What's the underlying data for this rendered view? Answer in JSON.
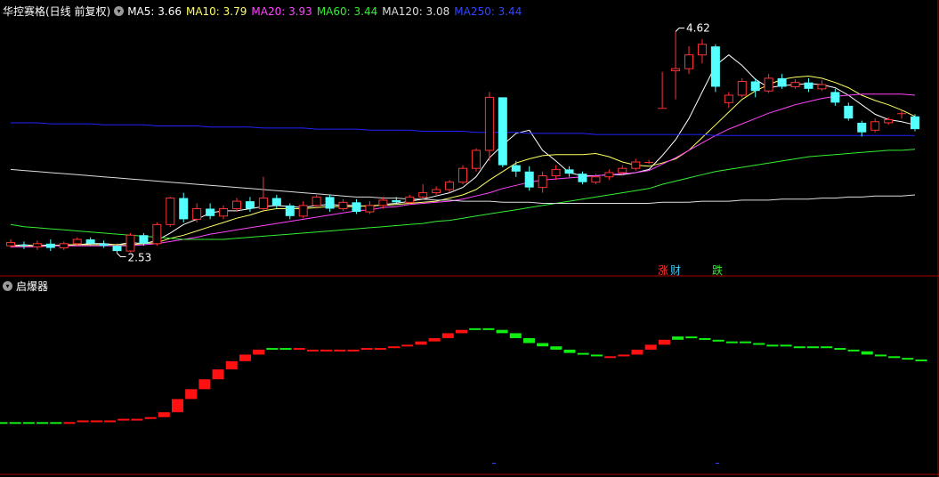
{
  "header": {
    "title": "华控赛格(日线 前复权)",
    "ma": [
      {
        "label": "MA5: ",
        "value": "3.66",
        "color": "#ffffff"
      },
      {
        "label": "MA10: ",
        "value": "3.79",
        "color": "#ffff66"
      },
      {
        "label": "MA20: ",
        "value": "3.93",
        "color": "#ff44ff"
      },
      {
        "label": "MA60: ",
        "value": "3.44",
        "color": "#33ee33"
      },
      {
        "label": "MA120: ",
        "value": "3.08",
        "color": "#dddddd"
      },
      {
        "label": "MA250: ",
        "value": "3.44",
        "color": "#3344ff"
      }
    ]
  },
  "sub_panel": {
    "title": "启爆器"
  },
  "tags": [
    {
      "text": "涨",
      "color": "#ff3333"
    },
    {
      "text": "财",
      "color": "#33ccff"
    },
    {
      "text": "跌",
      "color": "#33ee33"
    }
  ],
  "chart_data": [
    {
      "type": "candlestick",
      "title": "华控赛格(日线 前复权)",
      "ylim": [
        2.4,
        4.75
      ],
      "colors": {
        "up": "#ff3333",
        "down": "#54ffff",
        "ma250_line": "#2222ff"
      },
      "annotations": [
        {
          "text": "4.62",
          "kind": "high",
          "bar": 50,
          "value": 4.62
        },
        {
          "text": "2.53",
          "kind": "low",
          "bar": 8,
          "value": 2.53
        }
      ],
      "bars": [
        [
          2.6,
          2.63,
          2.66,
          2.58
        ],
        [
          2.61,
          2.6,
          2.64,
          2.57
        ],
        [
          2.59,
          2.62,
          2.65,
          2.56
        ],
        [
          2.62,
          2.58,
          2.66,
          2.55
        ],
        [
          2.58,
          2.62,
          2.64,
          2.56
        ],
        [
          2.62,
          2.66,
          2.68,
          2.6
        ],
        [
          2.66,
          2.62,
          2.68,
          2.6
        ],
        [
          2.62,
          2.6,
          2.65,
          2.58
        ],
        [
          2.6,
          2.55,
          2.62,
          2.53
        ],
        [
          2.55,
          2.7,
          2.72,
          2.54
        ],
        [
          2.7,
          2.62,
          2.72,
          2.6
        ],
        [
          2.62,
          2.8,
          2.82,
          2.6
        ],
        [
          2.8,
          3.05,
          3.06,
          2.78
        ],
        [
          3.05,
          2.85,
          3.1,
          2.82
        ],
        [
          2.85,
          2.95,
          3.0,
          2.82
        ],
        [
          2.95,
          2.88,
          3.0,
          2.85
        ],
        [
          2.88,
          2.95,
          2.98,
          2.85
        ],
        [
          2.95,
          3.02,
          3.05,
          2.92
        ],
        [
          3.02,
          2.95,
          3.06,
          2.92
        ],
        [
          2.95,
          3.05,
          3.25,
          2.93
        ],
        [
          3.05,
          2.98,
          3.08,
          2.95
        ],
        [
          2.98,
          2.88,
          3.0,
          2.85
        ],
        [
          2.88,
          2.98,
          3.02,
          2.86
        ],
        [
          2.98,
          3.06,
          3.08,
          2.95
        ],
        [
          3.06,
          2.95,
          3.08,
          2.92
        ],
        [
          2.95,
          3.01,
          3.04,
          2.93
        ],
        [
          3.01,
          2.92,
          3.04,
          2.9
        ],
        [
          2.92,
          2.98,
          3.02,
          2.9
        ],
        [
          2.98,
          3.03,
          3.06,
          2.95
        ],
        [
          3.03,
          3.01,
          3.06,
          2.99
        ],
        [
          3.01,
          3.06,
          3.08,
          2.99
        ],
        [
          3.06,
          3.1,
          3.18,
          3.04
        ],
        [
          3.1,
          3.13,
          3.16,
          3.08
        ],
        [
          3.13,
          3.2,
          3.22,
          3.1
        ],
        [
          3.2,
          3.33,
          3.36,
          3.18
        ],
        [
          3.33,
          3.5,
          3.52,
          3.3
        ],
        [
          3.5,
          4.0,
          4.05,
          3.4
        ],
        [
          4.0,
          3.36,
          4.0,
          3.34
        ],
        [
          3.36,
          3.3,
          3.4,
          3.25
        ],
        [
          3.3,
          3.15,
          3.35,
          3.12
        ],
        [
          3.15,
          3.26,
          3.3,
          3.1
        ],
        [
          3.26,
          3.32,
          3.36,
          3.22
        ],
        [
          3.32,
          3.28,
          3.35,
          3.25
        ],
        [
          3.28,
          3.2,
          3.3,
          3.18
        ],
        [
          3.2,
          3.25,
          3.28,
          3.18
        ],
        [
          3.25,
          3.29,
          3.32,
          3.22
        ],
        [
          3.29,
          3.33,
          3.36,
          3.26
        ],
        [
          3.33,
          3.39,
          3.42,
          3.31
        ],
        [
          3.39,
          3.39,
          3.41,
          3.37
        ],
        [
          3.9,
          3.9,
          4.24,
          3.9
        ],
        [
          4.25,
          4.27,
          4.62,
          3.98
        ],
        [
          4.27,
          4.4,
          4.48,
          4.22
        ],
        [
          4.4,
          4.5,
          4.55,
          4.32
        ],
        [
          4.48,
          4.1,
          4.5,
          4.05
        ],
        [
          3.95,
          4.02,
          4.05,
          3.9
        ],
        [
          4.02,
          4.15,
          4.18,
          4.0
        ],
        [
          4.15,
          4.06,
          4.18,
          4.0
        ],
        [
          4.06,
          4.18,
          4.22,
          4.04
        ],
        [
          4.18,
          4.1,
          4.22,
          4.08
        ],
        [
          4.1,
          4.14,
          4.17,
          4.08
        ],
        [
          4.14,
          4.08,
          4.18,
          4.05
        ],
        [
          4.08,
          4.12,
          4.16,
          4.06
        ],
        [
          4.05,
          3.95,
          4.08,
          3.92
        ],
        [
          3.92,
          3.8,
          3.95,
          3.78
        ],
        [
          3.76,
          3.67,
          3.78,
          3.63
        ],
        [
          3.69,
          3.77,
          3.8,
          3.67
        ],
        [
          3.76,
          3.79,
          3.81,
          3.74
        ],
        [
          3.85,
          3.85,
          3.88,
          3.8
        ],
        [
          3.82,
          3.7,
          3.84,
          3.68
        ]
      ],
      "moving_averages": {
        "MA5": [
          2.6,
          2.61,
          2.6,
          2.61,
          2.6,
          2.61,
          2.62,
          2.62,
          2.61,
          2.63,
          2.62,
          2.65,
          2.72,
          2.8,
          2.85,
          2.91,
          2.93,
          2.93,
          2.95,
          2.97,
          2.98,
          2.97,
          2.96,
          2.98,
          2.99,
          2.98,
          2.98,
          2.97,
          2.99,
          3.0,
          3.02,
          3.04,
          3.07,
          3.1,
          3.15,
          3.25,
          3.43,
          3.55,
          3.66,
          3.69,
          3.5,
          3.4,
          3.29,
          3.26,
          3.26,
          3.27,
          3.27,
          3.29,
          3.32,
          3.45,
          3.6,
          3.8,
          4.05,
          4.3,
          4.4,
          4.3,
          4.17,
          4.09,
          4.11,
          4.12,
          4.13,
          4.12,
          4.09,
          4.02,
          3.93,
          3.84,
          3.79,
          3.77,
          3.74
        ],
        "MA10": [
          2.6,
          2.6,
          2.6,
          2.6,
          2.61,
          2.61,
          2.61,
          2.61,
          2.61,
          2.61,
          2.62,
          2.63,
          2.67,
          2.7,
          2.74,
          2.78,
          2.82,
          2.86,
          2.89,
          2.93,
          2.95,
          2.95,
          2.95,
          2.96,
          2.97,
          2.97,
          2.97,
          2.98,
          2.98,
          2.99,
          3.0,
          3.01,
          3.02,
          3.05,
          3.08,
          3.13,
          3.22,
          3.3,
          3.38,
          3.42,
          3.45,
          3.46,
          3.46,
          3.46,
          3.47,
          3.44,
          3.39,
          3.36,
          3.35,
          3.38,
          3.42,
          3.5,
          3.62,
          3.74,
          3.86,
          3.98,
          4.06,
          4.12,
          4.17,
          4.19,
          4.2,
          4.18,
          4.14,
          4.09,
          4.02,
          3.97,
          3.93,
          3.88,
          3.82
        ],
        "MA20": [
          2.59,
          2.59,
          2.59,
          2.6,
          2.6,
          2.6,
          2.6,
          2.6,
          2.6,
          2.6,
          2.61,
          2.62,
          2.64,
          2.66,
          2.68,
          2.71,
          2.73,
          2.75,
          2.77,
          2.79,
          2.81,
          2.83,
          2.85,
          2.87,
          2.89,
          2.91,
          2.93,
          2.94,
          2.96,
          2.97,
          2.99,
          3.0,
          3.01,
          3.02,
          3.04,
          3.07,
          3.1,
          3.14,
          3.17,
          3.2,
          3.22,
          3.23,
          3.24,
          3.25,
          3.26,
          3.27,
          3.28,
          3.29,
          3.31,
          3.37,
          3.43,
          3.5,
          3.57,
          3.64,
          3.7,
          3.75,
          3.8,
          3.85,
          3.89,
          3.93,
          3.96,
          3.99,
          4.01,
          4.02,
          4.03,
          4.03,
          4.03,
          4.03,
          4.02
        ],
        "MA60": [
          2.8,
          2.78,
          2.77,
          2.76,
          2.75,
          2.74,
          2.73,
          2.72,
          2.71,
          2.7,
          2.69,
          2.68,
          2.67,
          2.66,
          2.66,
          2.66,
          2.66,
          2.67,
          2.68,
          2.69,
          2.7,
          2.71,
          2.72,
          2.73,
          2.74,
          2.75,
          2.76,
          2.77,
          2.78,
          2.79,
          2.8,
          2.81,
          2.83,
          2.84,
          2.86,
          2.88,
          2.9,
          2.92,
          2.94,
          2.96,
          2.98,
          3.0,
          3.02,
          3.04,
          3.06,
          3.08,
          3.1,
          3.12,
          3.14,
          3.18,
          3.21,
          3.24,
          3.27,
          3.3,
          3.32,
          3.34,
          3.36,
          3.38,
          3.4,
          3.42,
          3.44,
          3.45,
          3.46,
          3.47,
          3.48,
          3.49,
          3.5,
          3.5,
          3.51
        ],
        "MA120": [
          3.32,
          3.31,
          3.3,
          3.29,
          3.28,
          3.27,
          3.26,
          3.25,
          3.24,
          3.23,
          3.22,
          3.21,
          3.2,
          3.19,
          3.18,
          3.17,
          3.16,
          3.15,
          3.14,
          3.13,
          3.12,
          3.11,
          3.1,
          3.09,
          3.08,
          3.07,
          3.06,
          3.06,
          3.05,
          3.05,
          3.04,
          3.04,
          3.03,
          3.03,
          3.02,
          3.02,
          3.02,
          3.01,
          3.01,
          3.01,
          3.0,
          3.0,
          3.0,
          3.0,
          3.0,
          3.0,
          3.0,
          3.0,
          3.0,
          3.01,
          3.01,
          3.01,
          3.02,
          3.02,
          3.02,
          3.03,
          3.03,
          3.03,
          3.04,
          3.04,
          3.04,
          3.05,
          3.05,
          3.06,
          3.06,
          3.07,
          3.07,
          3.07,
          3.08
        ],
        "MA250": [
          3.76,
          3.76,
          3.76,
          3.75,
          3.75,
          3.75,
          3.75,
          3.74,
          3.74,
          3.74,
          3.74,
          3.73,
          3.73,
          3.73,
          3.73,
          3.72,
          3.72,
          3.72,
          3.72,
          3.71,
          3.71,
          3.71,
          3.71,
          3.7,
          3.7,
          3.7,
          3.7,
          3.69,
          3.69,
          3.69,
          3.69,
          3.68,
          3.68,
          3.68,
          3.68,
          3.67,
          3.67,
          3.67,
          3.67,
          3.66,
          3.66,
          3.66,
          3.66,
          3.66,
          3.65,
          3.65,
          3.65,
          3.65,
          3.65,
          3.65,
          3.65,
          3.65,
          3.65,
          3.64,
          3.64,
          3.64,
          3.64,
          3.64,
          3.64,
          3.64,
          3.64,
          3.64,
          3.64,
          3.64,
          3.64,
          3.64,
          3.64,
          3.64,
          3.64
        ]
      }
    },
    {
      "type": "bar",
      "title": "启爆器",
      "ylim": [
        0,
        100
      ],
      "colors": {
        "up": "#ff1111",
        "down": "#11ee11"
      },
      "values": [
        22,
        22,
        22,
        22,
        22,
        22,
        23,
        23,
        23,
        24,
        24,
        25,
        28,
        36,
        42,
        48,
        54,
        59,
        63,
        66,
        67,
        67,
        66,
        66,
        66,
        66,
        66,
        67,
        67,
        68,
        69,
        71,
        73,
        76,
        78,
        79,
        78,
        76,
        73,
        70,
        68,
        66,
        64,
        63,
        62,
        62,
        63,
        66,
        69,
        72,
        74,
        73,
        72,
        71,
        71,
        70,
        69,
        69,
        68,
        68,
        68,
        67,
        66,
        65,
        63,
        62,
        61,
        60,
        59
      ],
      "direction": [
        "d",
        "d",
        "d",
        "d",
        "d",
        "u",
        "u",
        "u",
        "u",
        "u",
        "u",
        "u",
        "u",
        "u",
        "u",
        "u",
        "u",
        "u",
        "u",
        "u",
        "d",
        "d",
        "u",
        "u",
        "u",
        "u",
        "u",
        "u",
        "u",
        "u",
        "u",
        "u",
        "u",
        "u",
        "u",
        "d",
        "d",
        "d",
        "d",
        "d",
        "d",
        "d",
        "d",
        "d",
        "d",
        "u",
        "u",
        "u",
        "u",
        "u",
        "d",
        "d",
        "d",
        "d",
        "d",
        "d",
        "d",
        "d",
        "d",
        "d",
        "d",
        "d",
        "d",
        "d",
        "d",
        "d",
        "d",
        "d",
        "d"
      ]
    }
  ]
}
